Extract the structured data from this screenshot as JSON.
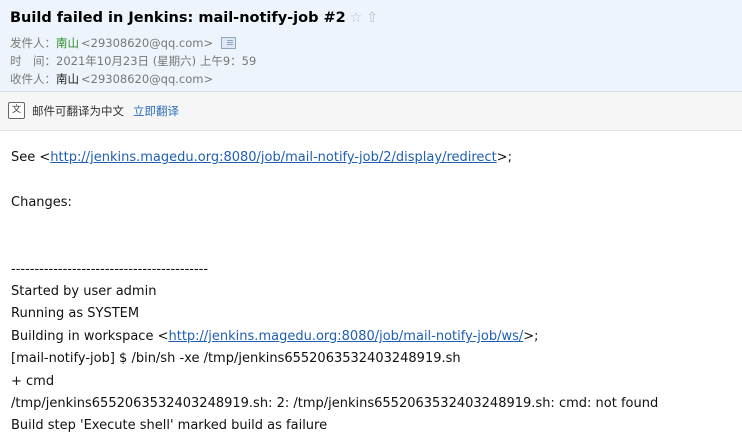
{
  "email": {
    "subject": "Build failed in Jenkins: mail-notify-job #2",
    "icons": {
      "star": "star-icon",
      "flag": "flag-icon"
    },
    "from_label": "发件人：",
    "from_name": "南山",
    "from_address": "<29308620@qq.com>",
    "time_label": "时　间：",
    "time_value": "2021年10月23日 (星期六) 上午9：59",
    "to_label": "收件人：",
    "to_name": "南山",
    "to_address": "<29308620@qq.com>"
  },
  "translate": {
    "notice": "邮件可翻译为中文",
    "action": "立即翻译"
  },
  "body": {
    "see_prefix": "See <",
    "see_link": "http://jenkins.magedu.org:8080/job/mail-notify-job/2/display/redirect",
    "see_suffix": ">;",
    "changes": "Changes:",
    "separator": "------------------------------------------",
    "started_by": "Started by user admin",
    "running_as": "Running as SYSTEM",
    "workspace_prefix": "Building in workspace <",
    "workspace_link": "http://jenkins.magedu.org:8080/job/mail-notify-job/ws/",
    "workspace_suffix": ">;",
    "shell_cmd": "[mail-notify-job] $ /bin/sh -xe /tmp/jenkins6552063532403248919.sh",
    "plus_cmd": "+ cmd",
    "not_found": "/tmp/jenkins6552063532403248919.sh: 2: /tmp/jenkins6552063532403248919.sh: cmd: not found",
    "build_failure": "Build step 'Execute shell' marked build as failure"
  },
  "colors": {
    "header_bg": "#eef4fb",
    "sender_green": "#2c8a2c",
    "link_blue": "#1e5fb4"
  }
}
